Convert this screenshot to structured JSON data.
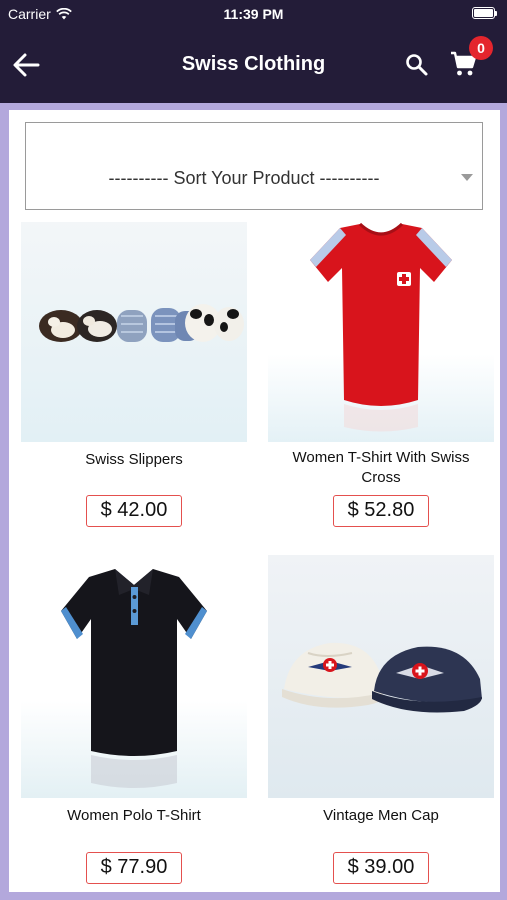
{
  "status_bar": {
    "carrier": "Carrier",
    "time": "11:39 PM"
  },
  "nav": {
    "title": "Swiss Clothing",
    "cart_count": "0"
  },
  "sort": {
    "label": "---------- Sort Your Product ----------"
  },
  "products": [
    {
      "name": "Swiss Slippers",
      "price": "$ 42.00"
    },
    {
      "name": "Women T-Shirt With Swiss Cross",
      "price": "$ 52.80"
    },
    {
      "name": "Women Polo T-Shirt",
      "price": "$ 77.90"
    },
    {
      "name": "Vintage Men Cap",
      "price": "$ 39.00"
    }
  ],
  "colors": {
    "header": "#231c38",
    "frame": "#b3a8dc",
    "badge": "#e4252d",
    "price_border": "#e4504e"
  }
}
